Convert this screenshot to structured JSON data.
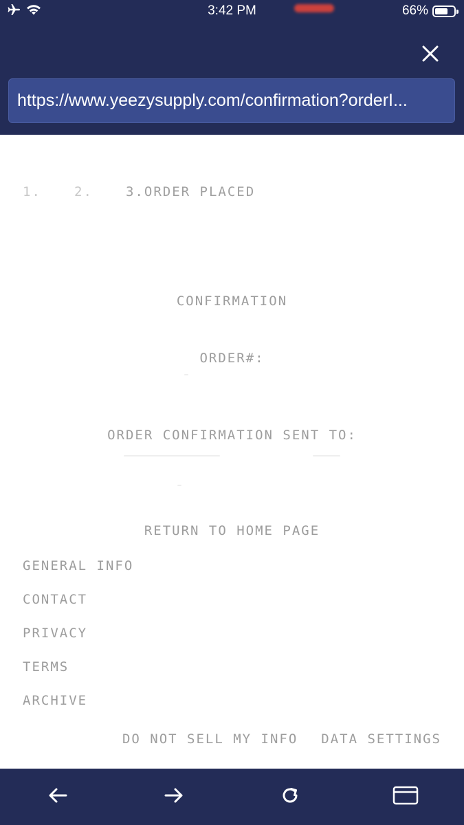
{
  "status_bar": {
    "time": "3:42 PM",
    "battery_percent": "66%",
    "battery_level": 0.66,
    "icons": [
      "airplane-icon",
      "wifi-icon",
      "battery-icon"
    ]
  },
  "browser": {
    "url": "https://www.yeezysupply.com/confirmation?orderI...",
    "close_icon": "close-icon"
  },
  "checkout_steps": {
    "step1": "1.",
    "step2": "2.",
    "step3": "3.ORDER PLACED"
  },
  "confirmation": {
    "heading": "CONFIRMATION",
    "order_label": "ORDER#:",
    "sent_to_label": "ORDER CONFIRMATION SENT TO:",
    "return_link": "RETURN TO HOME PAGE"
  },
  "footer": {
    "links": [
      "GENERAL INFO",
      "CONTACT",
      "PRIVACY",
      "TERMS",
      "ARCHIVE"
    ],
    "do_not_sell": "DO NOT SELL MY INFO",
    "data_settings": "DATA SETTINGS"
  },
  "toolbar": {
    "icons": [
      "back-arrow-icon",
      "forward-arrow-icon",
      "reload-icon",
      "card-icon"
    ]
  },
  "colors": {
    "chrome": "#232c57",
    "url_bar": "#3a4c8f",
    "text_gray": "#9d9d9d"
  }
}
